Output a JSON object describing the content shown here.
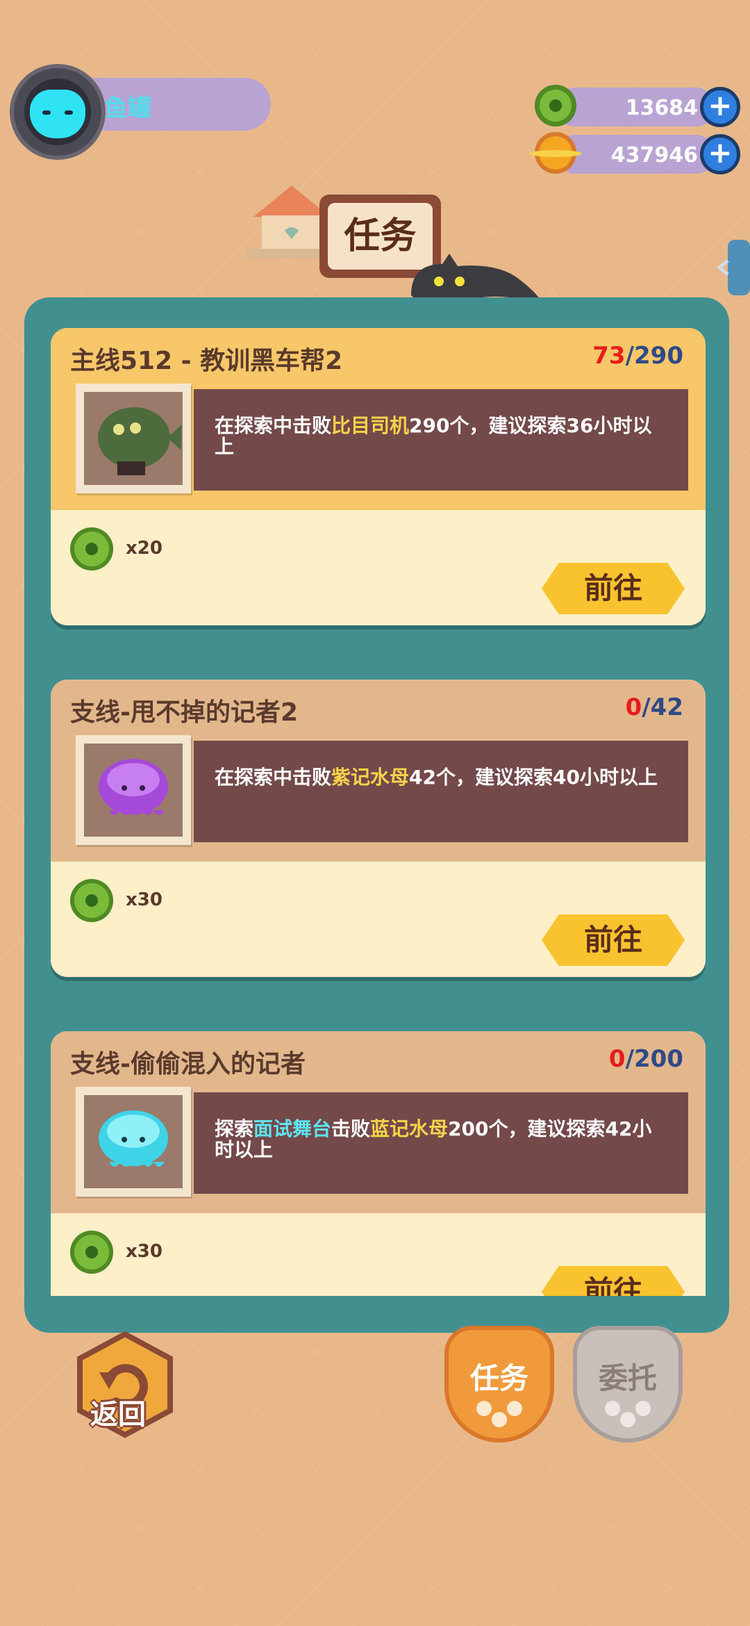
{
  "player": {
    "name": "鱼罐"
  },
  "currency": {
    "green_coin": "13684",
    "gold_coin": "437946",
    "plus_symbol": "+"
  },
  "header": {
    "title": "任务"
  },
  "quests": [
    {
      "title": "主线512 - 教训黑车帮2",
      "progress_current": "73",
      "progress_sep": "/",
      "progress_total": "290",
      "desc_parts": [
        "在探索中击败",
        "比目司机",
        "290个，建议探索36小时以上"
      ],
      "reward_count": "x20",
      "button": "前往",
      "level": {
        "current": 73,
        "total": 290
      }
    },
    {
      "title": "支线-甩不掉的记者2",
      "progress_current": "0",
      "progress_sep": "/",
      "progress_total": "42",
      "desc_parts": [
        "在探索中击败",
        "紫记水母",
        "42个，建议探索40小时以上"
      ],
      "reward_count": "x30",
      "button": "前往",
      "level": {
        "current": 0,
        "total": 42
      }
    },
    {
      "title": "支线-偷偷混入的记者",
      "progress_current": "0",
      "progress_sep": "/",
      "progress_total": "200",
      "desc_parts": [
        "探索",
        "面试舞台",
        "击败",
        "蓝记水母",
        "200个，建议探索42小时以上"
      ],
      "reward_count": "x30",
      "button": "前往",
      "level": {
        "current": 0,
        "total": 200
      }
    }
  ],
  "bottom": {
    "back_label": "返回",
    "tab_tasks": "任务",
    "tab_commission": "委托"
  },
  "colors": {
    "background": "#e8b88a",
    "panel": "#41908f",
    "card_main": "#f7c769",
    "card_side": "#e3b78c",
    "desc_box": "#73494a",
    "button": "#f8c32e",
    "progress_red": "#e81c1c",
    "progress_blue": "#2e4a86"
  },
  "icons": {
    "avatar": "cyan-cat-avatar",
    "green_coin": "green-donut-coin-icon",
    "gold_coin": "gold-planet-coin-icon",
    "quest1_image": "flatfish-driver-icon",
    "quest2_image": "purple-jellyfish-icon",
    "quest3_image": "blue-jellyfish-icon",
    "back": "return-arrow-icon"
  }
}
